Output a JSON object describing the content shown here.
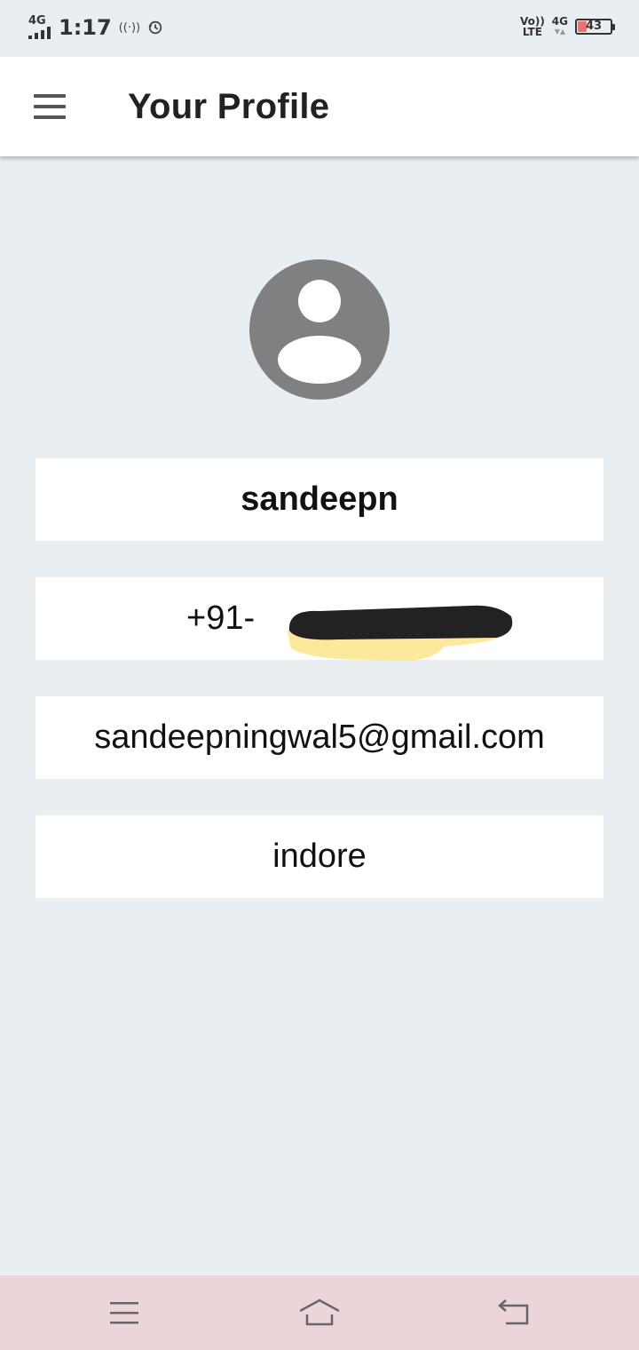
{
  "status_bar": {
    "network": "4G",
    "time": "1:17",
    "hotspot": "((·))",
    "volte_top": "Vo))",
    "volte_bottom": "LTE",
    "network_right": "4G",
    "network_right_arrows": "▼▲",
    "battery_level": "43",
    "battery_fill_color": "#f07070"
  },
  "app_bar": {
    "title": "Your Profile",
    "menu_icon": "hamburger-menu-icon"
  },
  "profile": {
    "avatar_icon": "person-icon",
    "name": "sandeepn",
    "phone_prefix": "+91-",
    "email": "sandeepningwal5@gmail.com",
    "city": "indore"
  },
  "nav_bar": {
    "recents_icon": "recents-icon",
    "home_icon": "home-icon",
    "back_icon": "back-icon"
  },
  "colors": {
    "background": "#e9eef3",
    "card": "#ffffff",
    "avatar": "#7f8082",
    "nav_bar": "#ebd5d9"
  }
}
